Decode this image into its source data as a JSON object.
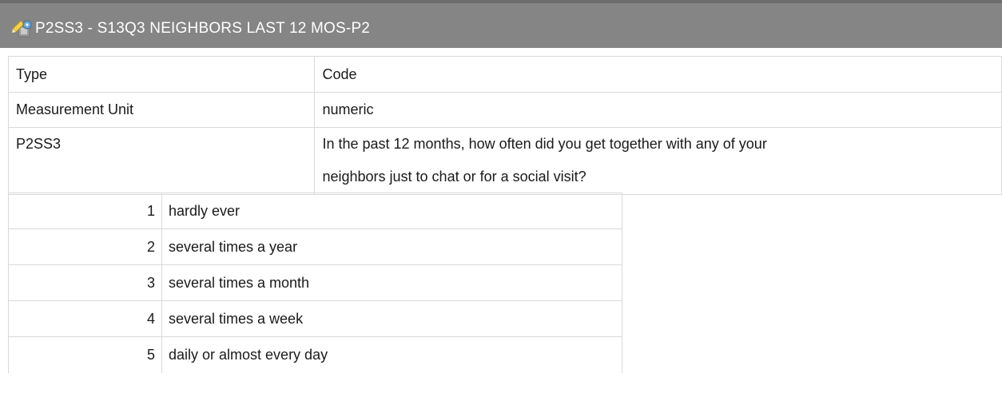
{
  "header": {
    "icon": "variable-icon",
    "title": "P2SS3 - S13Q3 NEIGHBORS LAST 12 MOS-P2"
  },
  "info_rows": [
    {
      "key": "Type",
      "value": "Code"
    },
    {
      "key": "Measurement Unit",
      "value": "numeric"
    },
    {
      "key": "P2SS3",
      "value_line1": "In the past 12 months, how often did you get together with any of your",
      "value_line2": "neighbors just to chat or for a social visit?"
    }
  ],
  "codes": [
    {
      "code": "1",
      "label": "hardly ever"
    },
    {
      "code": "2",
      "label": "several times a year"
    },
    {
      "code": "3",
      "label": "several times a month"
    },
    {
      "code": "4",
      "label": "several times a week"
    },
    {
      "code": "5",
      "label": "daily or almost every day"
    }
  ],
  "colors": {
    "header_bg": "#858585",
    "border": "#d9d9d9"
  }
}
